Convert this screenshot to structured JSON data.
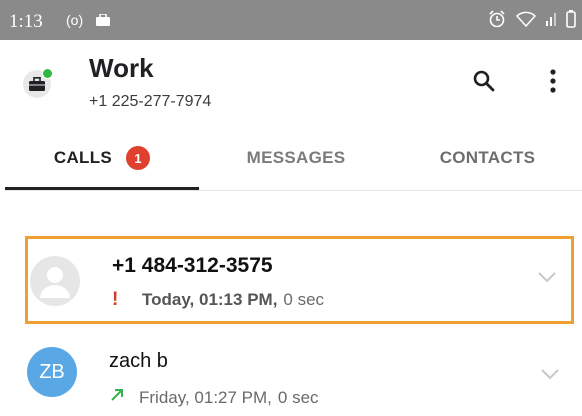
{
  "status_bar": {
    "time": "1:13",
    "cast_glyph": "(o)"
  },
  "account": {
    "name": "Work",
    "number": "+1 225-277-7974"
  },
  "tabs": [
    {
      "label": "CALLS",
      "badge": "1"
    },
    {
      "label": "MESSAGES"
    },
    {
      "label": "CONTACTS"
    }
  ],
  "calls": [
    {
      "caller": "+1 484-312-3575",
      "timestamp": "Today, 01:13 PM,",
      "duration": "0 sec",
      "type_icon": "missed-call-icon"
    },
    {
      "caller": "zach b",
      "initials": "ZB",
      "timestamp": "Friday, 01:27 PM,",
      "duration": "0 sec",
      "type_icon": "outgoing-call-icon"
    }
  ],
  "colors": {
    "accent_highlight": "#f0a030",
    "badge": "#e0402f",
    "avatar_zb": "#5aa7e6",
    "status_bar": "#8a8a8a",
    "online_dot": "#2fb843"
  }
}
